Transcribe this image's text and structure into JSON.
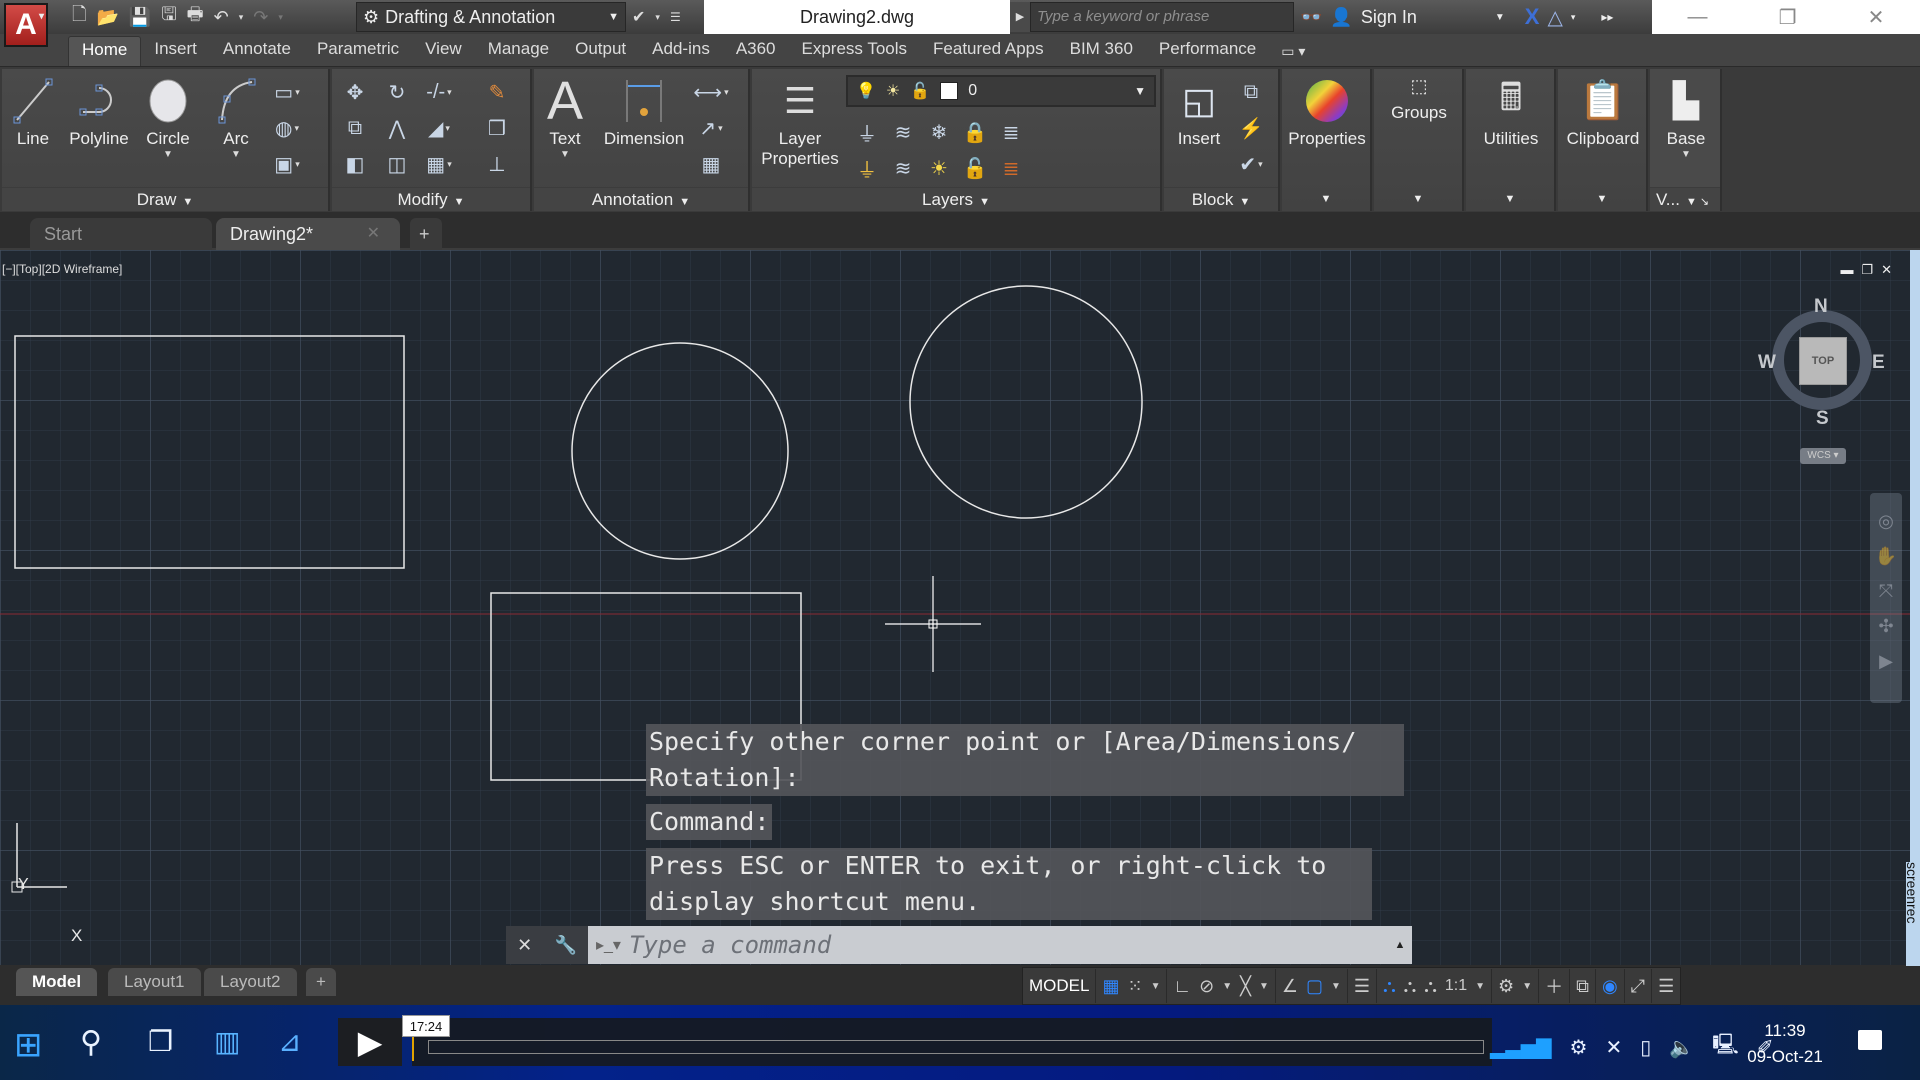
{
  "title_bar": {
    "app_icon": "autocad-logo",
    "app_letter": "A",
    "quick_access": [
      "new-icon",
      "open-icon",
      "save-icon",
      "save-as-icon",
      "plot-icon",
      "undo-icon",
      "redo-icon"
    ],
    "workspace": "Drafting & Annotation",
    "filename": "Drawing2.dwg",
    "search_placeholder": "Type a keyword or phrase",
    "sign_in": "Sign In",
    "window_controls": {
      "minimize": "—",
      "restore": "❐",
      "close": "✕"
    }
  },
  "ribbon_tabs": [
    "Home",
    "Insert",
    "Annotate",
    "Parametric",
    "View",
    "Manage",
    "Output",
    "Add-ins",
    "A360",
    "Express Tools",
    "Featured Apps",
    "BIM 360",
    "Performance"
  ],
  "active_ribbon_tab": "Home",
  "panels": {
    "draw": {
      "title": "Draw",
      "buttons": [
        "Line",
        "Polyline",
        "Circle",
        "Arc"
      ]
    },
    "modify": {
      "title": "Modify"
    },
    "annotation": {
      "title": "Annotation",
      "buttons": [
        "Text",
        "Dimension"
      ]
    },
    "layers": {
      "title": "Layers",
      "button_line1": "Layer",
      "button_line2": "Properties",
      "current_layer": "0"
    },
    "block": {
      "title": "Block",
      "buttons": [
        "Insert"
      ]
    },
    "properties": {
      "label": "Properties"
    },
    "groups": {
      "label": "Groups"
    },
    "utilities": {
      "label": "Utilities"
    },
    "clipboard": {
      "label": "Clipboard"
    },
    "view": {
      "label": "Base",
      "title": "V..."
    }
  },
  "doc_tabs": {
    "start": "Start",
    "drawing": "Drawing2*",
    "add": "+"
  },
  "viewport": {
    "label": "[−][Top][2D Wireframe]",
    "controls": {
      "minimize": "▬",
      "restore": "❐",
      "close": "✕"
    },
    "viewcube": {
      "n": "N",
      "s": "S",
      "e": "E",
      "w": "W",
      "face": "TOP",
      "wcs": "WCS ▾"
    },
    "ucs": {
      "x": "X",
      "y": "Y"
    }
  },
  "command": {
    "history": [
      "Specify other corner point or [Area/Dimensions/",
      "Rotation]:",
      "Command:",
      "Press ESC or ENTER to exit, or right-click to",
      "display shortcut menu."
    ],
    "placeholder": "Type a command",
    "close": "✕",
    "customize": "🔧"
  },
  "layout_tabs": [
    "Model",
    "Layout1",
    "Layout2",
    "+"
  ],
  "status_bar": {
    "model": "MODEL",
    "scale": "1:1"
  },
  "taskbar": {
    "media_time": "17:24",
    "clock_time": "11:39",
    "clock_date": "09-Oct-21"
  },
  "watermark": "screenrec"
}
